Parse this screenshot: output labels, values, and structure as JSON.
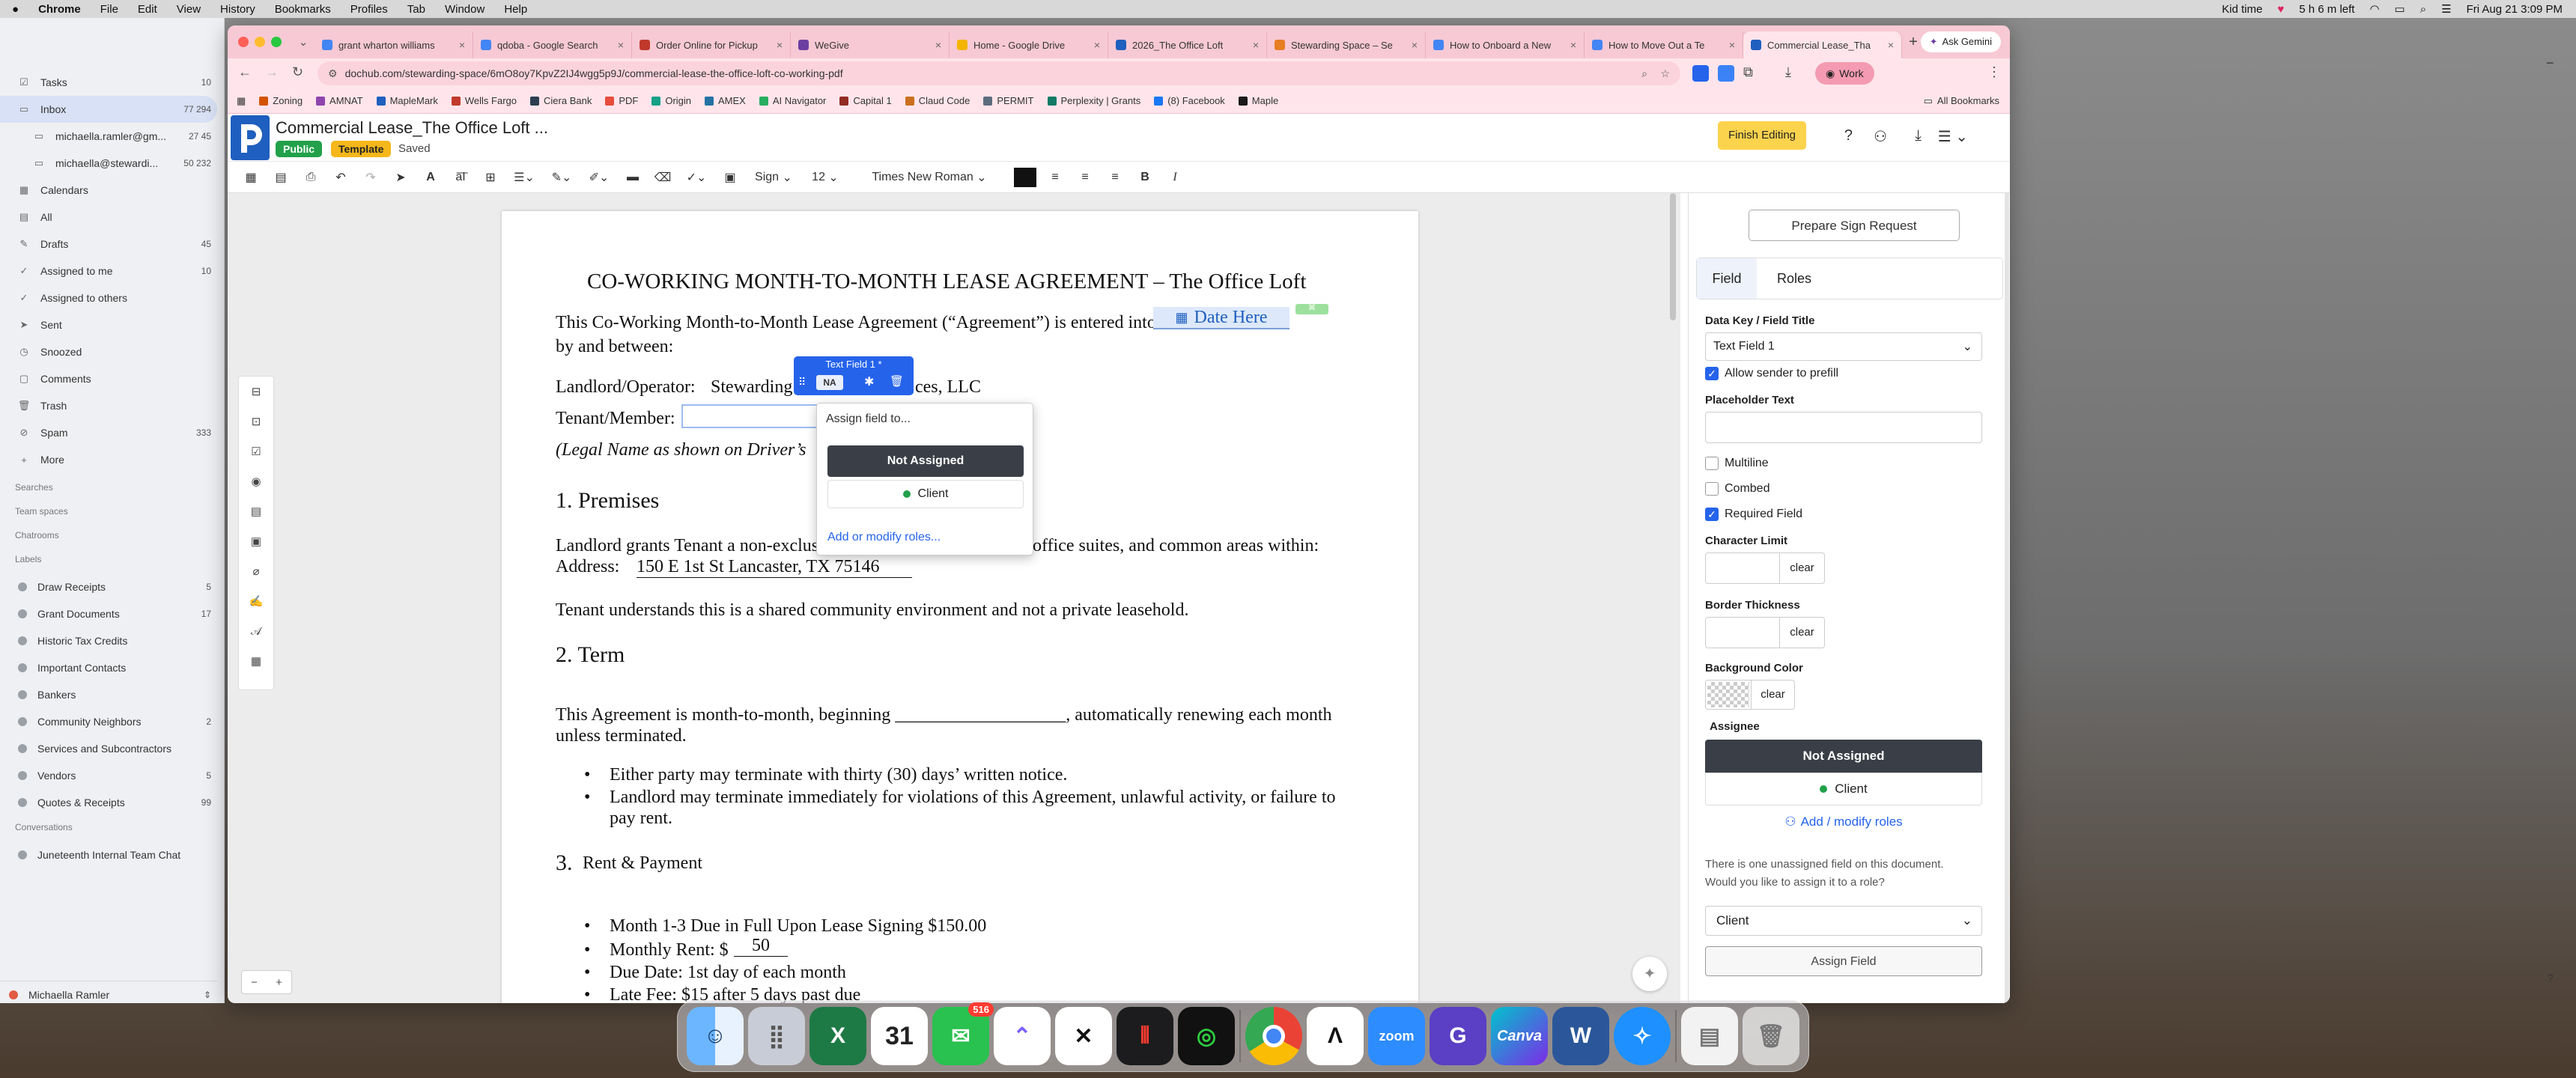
{
  "menubar": {
    "app": "Chrome",
    "items": [
      "File",
      "Edit",
      "View",
      "History",
      "Bookmarks",
      "Profiles",
      "Tab",
      "Window",
      "Help"
    ],
    "status_kid_time": "Kid time",
    "status_time_left": "5 h 6 m left",
    "datetime": "Fri Aug 21  3:09 PM"
  },
  "mail": {
    "rows": [
      {
        "label": "Tasks",
        "count": "10",
        "icon": "task-icon"
      },
      {
        "label": "Inbox",
        "count": "77  294",
        "icon": "inbox-icon",
        "selected": true
      },
      {
        "label": "michaella.ramler@gm...",
        "count": "27  45",
        "icon": "account-icon"
      },
      {
        "label": "michaella@stewardi...",
        "count": "50  232",
        "icon": "account-icon"
      },
      {
        "label": "Calendars",
        "count": "",
        "icon": "calendar-icon"
      },
      {
        "label": "All",
        "count": "",
        "icon": "all-icon"
      },
      {
        "label": "Drafts",
        "count": "45",
        "icon": "drafts-icon"
      },
      {
        "label": "Assigned to me",
        "count": "10",
        "icon": "assigned-icon"
      },
      {
        "label": "Assigned to others",
        "count": "",
        "icon": "assigned-others-icon"
      },
      {
        "label": "Sent",
        "count": "",
        "icon": "sent-icon"
      },
      {
        "label": "Snoozed",
        "count": "",
        "icon": "snooze-icon"
      },
      {
        "label": "Comments",
        "count": "",
        "icon": "comment-icon"
      },
      {
        "label": "Trash",
        "count": "",
        "icon": "trash-icon"
      },
      {
        "label": "Spam",
        "count": "333",
        "icon": "spam-icon"
      },
      {
        "label": "More",
        "count": "",
        "icon": "plus-icon"
      }
    ],
    "section_searches": "Searches",
    "section_team_spaces": "Team spaces",
    "section_chatrooms": "Chatrooms",
    "section_labels": "Labels",
    "labels": [
      {
        "label": "Draw Receipts",
        "count": "5"
      },
      {
        "label": "Grant Documents",
        "count": "17"
      },
      {
        "label": "Historic Tax Credits",
        "count": ""
      },
      {
        "label": "Important Contacts",
        "count": ""
      },
      {
        "label": "Bankers",
        "count": ""
      },
      {
        "label": "Community Neighbors",
        "count": "2"
      },
      {
        "label": "Services and Subcontractors",
        "count": ""
      },
      {
        "label": "Vendors",
        "count": "5"
      },
      {
        "label": "Quotes & Receipts",
        "count": "99"
      }
    ],
    "section_conversations": "Conversations",
    "conversation": "Juneteenth Internal Team Chat",
    "user": "Michaella Ramler"
  },
  "tabs": [
    {
      "title": "grant wharton williams",
      "color": "#4285f4"
    },
    {
      "title": "qdoba - Google Search",
      "color": "#4285f4"
    },
    {
      "title": "Order Online for Pickup",
      "color": "#c0392b"
    },
    {
      "title": "WeGive",
      "color": "#6b3fa0"
    },
    {
      "title": "Home - Google Drive",
      "color": "#f4b400"
    },
    {
      "title": "2026_The Office Loft",
      "color": "#1f5fbf"
    },
    {
      "title": "Stewarding Space – Se",
      "color": "#e67e22"
    },
    {
      "title": "How to Onboard a New",
      "color": "#4285f4"
    },
    {
      "title": "How to Move Out a Te",
      "color": "#4285f4"
    },
    {
      "title": "Commercial Lease_Tha",
      "color": "#1f5fbf",
      "active": true
    }
  ],
  "browser": {
    "ask_gemini": "Ask Gemini",
    "url": "dochub.com/stewarding-space/6mO8oy7KpvZ2IJ4wgg5p9J/commercial-lease-the-office-loft-co-working-pdf",
    "profile": "Work",
    "all_bookmarks": "All Bookmarks",
    "bookmarks": [
      "Zoning",
      "AMNAT",
      "MapleMark",
      "Wells Fargo",
      "Ciera Bank",
      "PDF",
      "Origin",
      "AMEX",
      "AI Navigator",
      "Capital 1",
      "Claud Code",
      "PERMIT",
      "Perplexity | Grants",
      "(8) Facebook",
      "Maple"
    ]
  },
  "app": {
    "title": "Commercial Lease_The Office Loft ...",
    "badge_public": "Public",
    "badge_template": "Template",
    "saved": "Saved",
    "finish": "Finish Editing",
    "sign_label": "Sign",
    "font_size": "12",
    "font_name": "Times New Roman"
  },
  "document": {
    "heading": "CO-WORKING MONTH-TO-MONTH LEASE AGREEMENT – The Office Loft",
    "intro1": "This Co-Working Month-to-Month Lease Agreement (“Agreement”) is entered into on this",
    "date_field": "Date Here",
    "intro2": "by and between:",
    "landlord_label": "Landlord/Operator:",
    "landlord_value": "Stewarding S",
    "landlord_tail": "ces, LLC",
    "tenant_label": "Tenant/Member:",
    "legal_name": "(Legal Name as shown on Driver’s",
    "sec1": "1. Premises",
    "premises1": "Landlord grants Tenant a non-exclusive license to use desk space, office suites, and common areas within:",
    "address_label": "Address:",
    "address_value": "150 E 1st St Lancaster, TX 75146",
    "premises2": "Tenant understands this is a shared community environment and not a private leasehold.",
    "sec2": "2. Term",
    "term1": "This Agreement is month-to-month, beginning ___________________, automatically renewing each month",
    "term2": "unless terminated.",
    "bullet1": "Either party may terminate with thirty (30) days’ written notice.",
    "bullet2a": "Landlord may terminate immediately for violations of this Agreement, unlawful activity, or failure to",
    "bullet2b": "pay rent.",
    "sec3": "3.",
    "sec3_title": "Rent & Payment",
    "rent1": "Month 1-3 Due in Full Upon Lease Signing $150.00",
    "rent2_label": "Monthly Rent: $",
    "rent2_value": "50",
    "rent3": "Due Date: 1st day of each month",
    "rent4": "Late Fee: $15 after 5 days past due"
  },
  "field_chip": {
    "title": "Text Field 1 *",
    "na": "NA"
  },
  "popup": {
    "assign": "Assign field to...",
    "not_assigned": "Not Assigned",
    "client": "Client",
    "modify": "Add or modify roles..."
  },
  "rpanel": {
    "prepare": "Prepare Sign Request",
    "tab_field": "Field",
    "tab_roles": "Roles",
    "data_key_label": "Data Key / Field Title",
    "data_key_value": "Text Field 1",
    "allow_prefill": "Allow sender to prefill",
    "placeholder_label": "Placeholder Text",
    "multiline": "Multiline",
    "combed": "Combed",
    "required": "Required Field",
    "char_limit": "Character Limit",
    "border_thickness": "Border Thickness",
    "background_color": "Background Color",
    "clear": "clear",
    "assignee": "Assignee",
    "not_assigned": "Not Assigned",
    "client": "Client",
    "add_roles": "Add / modify roles",
    "unassigned_note1": "There is one unassigned field on this document.",
    "unassigned_note2": "Would you like to assign it to a role?",
    "role_select": "Client",
    "assign_field": "Assign Field"
  },
  "colors": {
    "accent": "#1f5fbf",
    "public": "#22a04a",
    "template": "#f5b71a",
    "finish": "#fcd34d",
    "chip": "#2563eb",
    "dark": "#3a3f47"
  },
  "dock": {
    "messages_badge": "516",
    "apps": [
      "finder-icon",
      "launchpad-icon",
      "excel-icon",
      "calendar-icon",
      "clickup-icon",
      "capcut-icon",
      "voice-memos-icon",
      "speedtest-icon",
      "chrome-icon",
      "arc-icon",
      "zoom-icon",
      "gemini-icon",
      "canva-icon",
      "word-icon",
      "safari-icon",
      "preview-icon",
      "trash-icon"
    ],
    "calendar_day": "31",
    "zoom_label": "zoom",
    "canva_label": "Canva"
  }
}
